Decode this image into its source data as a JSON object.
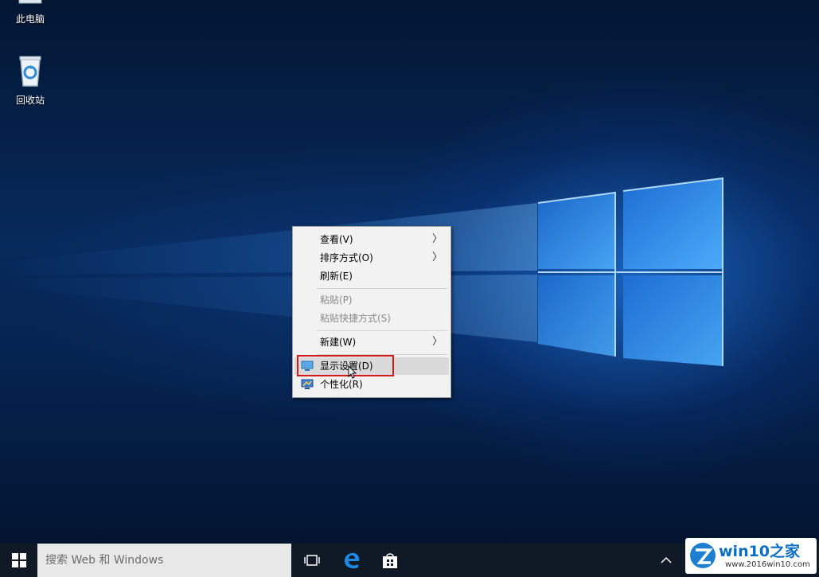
{
  "desktop": {
    "icons": [
      {
        "label": "此电脑"
      },
      {
        "label": "回收站"
      }
    ]
  },
  "context_menu": {
    "items": [
      {
        "label": "查看(V)",
        "submenu": true,
        "enabled": true
      },
      {
        "label": "排序方式(O)",
        "submenu": true,
        "enabled": true
      },
      {
        "label": "刷新(E)",
        "submenu": false,
        "enabled": true
      },
      {
        "label": "粘贴(P)",
        "submenu": false,
        "enabled": false
      },
      {
        "label": "粘贴快捷方式(S)",
        "submenu": false,
        "enabled": false
      },
      {
        "label": "新建(W)",
        "submenu": true,
        "enabled": true
      },
      {
        "label": "显示设置(D)",
        "submenu": false,
        "enabled": true,
        "icon": "display-icon",
        "highlighted": true
      },
      {
        "label": "个性化(R)",
        "submenu": false,
        "enabled": true,
        "icon": "personalize-icon"
      }
    ],
    "highlight_color": "#d21a1a"
  },
  "taskbar": {
    "search_placeholder": "搜索 Web 和 Windows",
    "icons": [
      "start-icon",
      "task-view-icon",
      "edge-icon",
      "store-icon",
      "chevron-up-icon"
    ]
  },
  "watermark": {
    "title": "win10之家",
    "url": "www.2016win10.com"
  }
}
